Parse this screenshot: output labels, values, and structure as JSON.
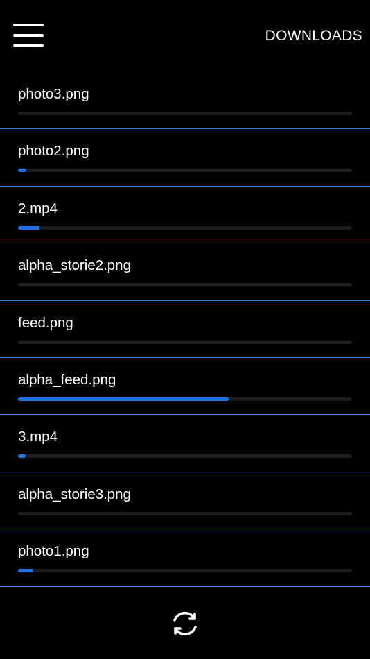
{
  "header": {
    "menu_icon": "hamburger-menu-icon",
    "title": "DOWNLOADS"
  },
  "colors": {
    "background": "#000000",
    "accent": "#1a73e8",
    "divider": "#2f7fe0",
    "track": "#1e1e1e",
    "text": "#ffffff"
  },
  "downloads": [
    {
      "name": "photo3.png",
      "progress": 0.0
    },
    {
      "name": "photo2.png",
      "progress": 0.025
    },
    {
      "name": "2.mp4",
      "progress": 0.065
    },
    {
      "name": "alpha_storie2.png",
      "progress": 0.0
    },
    {
      "name": "feed.png",
      "progress": 0.0
    },
    {
      "name": "alpha_feed.png",
      "progress": 0.63
    },
    {
      "name": "3.mp4",
      "progress": 0.022
    },
    {
      "name": "alpha_storie3.png",
      "progress": 0.0
    },
    {
      "name": "photo1.png",
      "progress": 0.045
    }
  ],
  "footer": {
    "refresh_icon": "refresh-icon"
  }
}
